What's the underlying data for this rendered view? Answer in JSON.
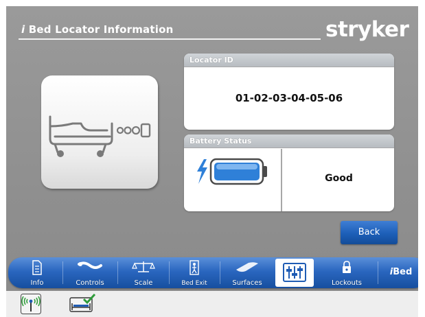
{
  "header": {
    "title_mark": "i",
    "title": "Bed Locator Information",
    "brand": "stryker"
  },
  "locator": {
    "label": "Locator ID",
    "value": "01-02-03-04-05-06"
  },
  "battery": {
    "label": "Battery Status",
    "value": "Good",
    "icon": "battery-charging-icon"
  },
  "back_label": "Back",
  "nav": {
    "items": [
      {
        "label": "Info",
        "icon": "info-icon"
      },
      {
        "label": "Controls",
        "icon": "controls-icon"
      },
      {
        "label": "Scale",
        "icon": "scale-icon"
      },
      {
        "label": "Bed Exit",
        "icon": "bed-exit-icon"
      },
      {
        "label": "Surfaces",
        "icon": "surfaces-icon"
      },
      {
        "label": "",
        "icon": "sliders-icon"
      },
      {
        "label": "Lockouts",
        "icon": "lock-icon"
      }
    ],
    "ibed_mark": "i",
    "ibed_label": "Bed"
  },
  "status": {
    "icons": [
      "wireless-signal-icon",
      "bed-status-check-icon"
    ]
  },
  "colors": {
    "background": "#8f8f8f",
    "nav_blue": "#2a66bf",
    "button_blue": "#1d5fb8",
    "battery_blue": "#2f80d8"
  }
}
